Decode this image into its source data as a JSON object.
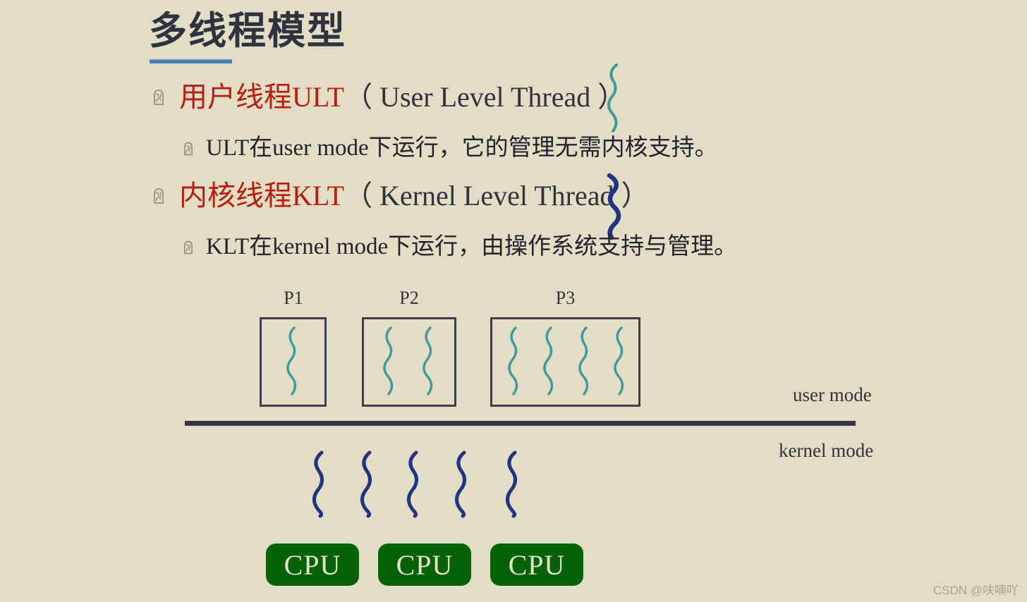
{
  "slide": {
    "title": "多线程模型",
    "background_color": "#E2DDC4",
    "accent_rule_color": "#4A7EBB",
    "heading_red": "#B81D12",
    "body_dark": "#2F3340",
    "user_thread_color": "#3E9AA0",
    "kernel_thread_color": "#1F3484",
    "cpu_fill": "#066206",
    "cpu_text_color": "#E7E2CB"
  },
  "bullets": [
    {
      "level": 1,
      "icon": "thinking-head-icon",
      "text_red": "用户线程ULT",
      "text_dark": "（ User Level Thread ）",
      "trailing_squiggle": "user-thread-squiggle"
    },
    {
      "level": 2,
      "icon": "thinking-head-icon",
      "text_dark": "ULT在user mode下运行，它的管理无需内核支持。"
    },
    {
      "level": 1,
      "icon": "thinking-head-icon",
      "text_red": "内核线程KLT",
      "text_dark": "（ Kernel Level Thread ）",
      "trailing_squiggle": "kernel-thread-squiggle"
    },
    {
      "level": 2,
      "icon": "thinking-head-icon",
      "text_dark": "KLT在kernel mode下运行，由操作系统支持与管理。"
    }
  ],
  "diagram": {
    "processes": [
      {
        "label": "P1",
        "thread_count": 1
      },
      {
        "label": "P2",
        "thread_count": 2
      },
      {
        "label": "P3",
        "thread_count": 4
      }
    ],
    "user_mode_label": "user mode",
    "kernel_mode_label": "kernel mode",
    "kernel_thread_count": 5,
    "cpus": [
      {
        "label": "CPU"
      },
      {
        "label": "CPU"
      },
      {
        "label": "CPU"
      }
    ]
  },
  "watermark": "CSDN @呋喃吖"
}
